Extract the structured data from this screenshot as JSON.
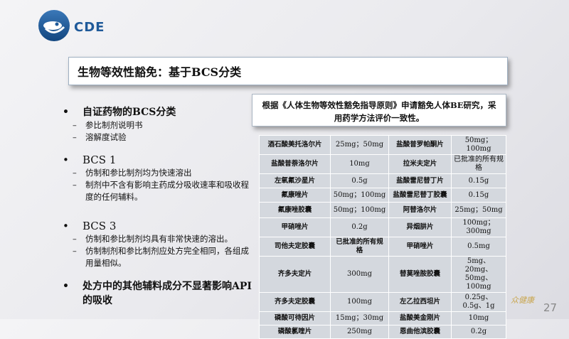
{
  "header": {
    "logo_text": "CDE",
    "colors": {
      "logo_blue": "#1f5a99",
      "table_cell": "#d4d8de",
      "watermark": "#c9a64f"
    }
  },
  "title": "生物等效性豁免：基于BCS分类",
  "note": "根据《人体生物等效性豁免指导原则》申请豁免人体BE研究，采用药学方法评价一致性。",
  "left": {
    "bullet_symbol": "•",
    "dash_symbol": "–",
    "items": [
      {
        "label": "自证药物的BCS分类",
        "subs": [
          "参比制剂说明书",
          "溶解度试验"
        ]
      },
      {
        "label": "BCS 1",
        "subs": [
          "仿制和参比制剂均为快速溶出",
          "制剂中不含有影响主药成分吸收速率和吸收程度的任何辅料。"
        ]
      },
      {
        "label": "BCS 3",
        "subs": [
          "仿制和参比制剂均具有非常快速的溶出。",
          "仿制制剂和参比制剂应处方完全相同，各组成用量相似。"
        ]
      },
      {
        "label": "处方中的其他辅料成分不显著影响API的吸收",
        "subs": []
      }
    ]
  },
  "table": {
    "rows": [
      [
        "酒石酸美托洛尔片",
        "25mg；50mg",
        "盐酸普罗帕酮片",
        "50mg；100mg"
      ],
      [
        "盐酸普萘洛尔片",
        "10mg",
        "拉米夫定片",
        "已批准的所有规格"
      ],
      [
        "左氧氟沙星片",
        "0.5g",
        "盐酸雷尼替丁片",
        "0.15g"
      ],
      [
        "氟康唑片",
        "50mg；100mg",
        "盐酸雷尼替丁胶囊",
        "0.15g"
      ],
      [
        "氟康唑胶囊",
        "50mg；100mg",
        "阿替洛尔片",
        "25mg；50mg"
      ],
      [
        "甲硝唑片",
        "0.2g",
        "异烟肼片",
        "100mg；300mg"
      ],
      [
        "司他夫定胶囊",
        "已批准的所有规格",
        "甲硝唑片",
        "0.5mg"
      ],
      [
        "齐多夫定片",
        "300mg",
        "替莫唑胺胶囊",
        "5mg、20mg、50mg、100mg"
      ],
      [
        "齐多夫定胶囊",
        "100mg",
        "左乙拉西坦片",
        "0.25g、0.5g、1g"
      ],
      [
        "磷酸可待因片",
        "15mg；30mg",
        "盐酸美金刚片",
        "10mg"
      ],
      [
        "磷酸氯喹片",
        "250mg",
        "恩曲他滨胶囊",
        "0.2g"
      ]
    ]
  },
  "watermark": "众健康",
  "page_number": "27"
}
